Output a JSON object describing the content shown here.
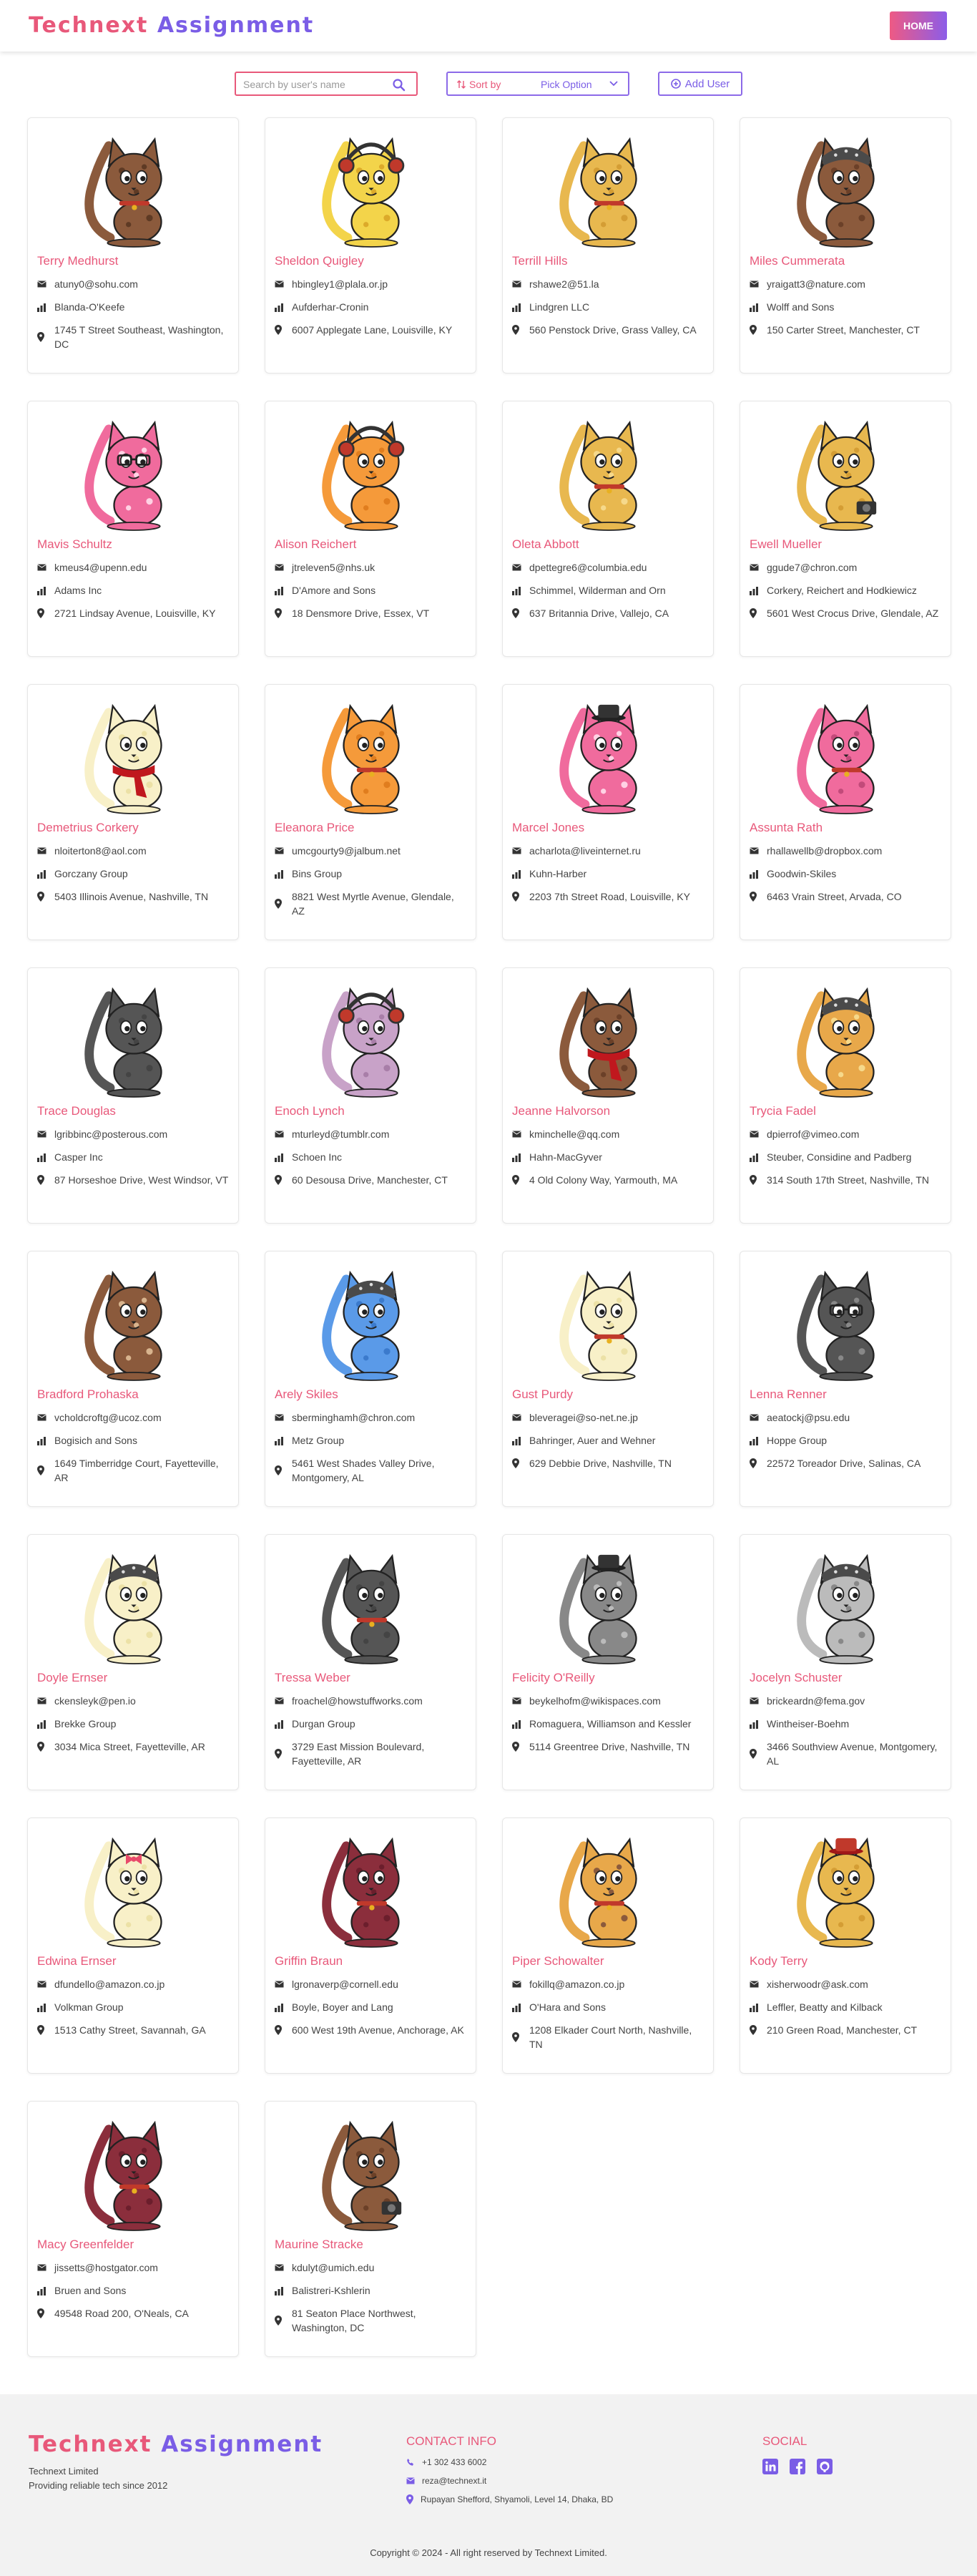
{
  "app": {
    "logo_part1": "Technext",
    "logo_part2": "Assignment",
    "home_label": "HOME"
  },
  "controls": {
    "search_placeholder": "Search by user's name",
    "sort_label": "Sort by",
    "sort_value": "Pick Option",
    "add_user_label": "Add User"
  },
  "colors": {
    "accent_pink": "#e8587a",
    "accent_purple": "#7a5de6"
  },
  "users": [
    {
      "name": "Terry Medhurst",
      "email": "atuny0@sohu.com",
      "company": "Blanda-O'Keefe",
      "address": "1745 T Street Southeast, Washington, DC",
      "cat": {
        "body": "#8b5a3c",
        "spots": "#5e3a24",
        "acc": "collar"
      }
    },
    {
      "name": "Sheldon Quigley",
      "email": "hbingley1@plala.or.jp",
      "company": "Aufderhar-Cronin",
      "address": "6007 Applegate Lane, Louisville, KY",
      "cat": {
        "body": "#f3d44a",
        "spots": "#dcaa2a",
        "acc": "headphones"
      }
    },
    {
      "name": "Terrill Hills",
      "email": "rshawe2@51.la",
      "company": "Lindgren LLC",
      "address": "560 Penstock Drive, Grass Valley, CA",
      "cat": {
        "body": "#e8b84f",
        "spots": "#d49d34",
        "acc": "collar"
      }
    },
    {
      "name": "Miles Cummerata",
      "email": "yraigatt3@nature.com",
      "company": "Wolff and Sons",
      "address": "150 Carter Street, Manchester, CT",
      "cat": {
        "body": "#8b5a3c",
        "spots": "#6b4028",
        "acc": "bandana"
      }
    },
    {
      "name": "Mavis Schultz",
      "email": "kmeus4@upenn.edu",
      "company": "Adams Inc",
      "address": "2721 Lindsay Avenue, Louisville, KY",
      "cat": {
        "body": "#f06b9d",
        "spots": "#ffd2e4",
        "acc": "glasses"
      }
    },
    {
      "name": "Alison Reichert",
      "email": "jtreleven5@nhs.uk",
      "company": "D'Amore and Sons",
      "address": "18 Densmore Drive, Essex, VT",
      "cat": {
        "body": "#f59a3a",
        "spots": "#e07d1e",
        "acc": "headphones"
      }
    },
    {
      "name": "Oleta Abbott",
      "email": "dpettegre6@columbia.edu",
      "company": "Schimmel, Wilderman and Orn",
      "address": "637 Britannia Drive, Vallejo, CA",
      "cat": {
        "body": "#e8b84f",
        "spots": "#f6d98b",
        "acc": "collar"
      }
    },
    {
      "name": "Ewell Mueller",
      "email": "ggude7@chron.com",
      "company": "Corkery, Reichert and Hodkiewicz",
      "address": "5601 West Crocus Drive, Glendale, AZ",
      "cat": {
        "body": "#e8b84f",
        "spots": "#d49d34",
        "acc": "camera"
      }
    },
    {
      "name": "Demetrius Corkery",
      "email": "nloiterton8@aol.com",
      "company": "Gorczany Group",
      "address": "5403 Illinois Avenue, Nashville, TN",
      "cat": {
        "body": "#f8f0c8",
        "spots": "#ece1a6",
        "acc": "scarf"
      }
    },
    {
      "name": "Eleanora Price",
      "email": "umcgourty9@jalbum.net",
      "company": "Bins Group",
      "address": "8821 West Myrtle Avenue, Glendale, AZ",
      "cat": {
        "body": "#f59a3a",
        "spots": "#e07d1e",
        "acc": "collar"
      }
    },
    {
      "name": "Marcel Jones",
      "email": "acharlota@liveinternet.ru",
      "company": "Kuhn-Harber",
      "address": "2203 7th Street Road, Louisville, KY",
      "cat": {
        "body": "#f06b9d",
        "spots": "#ffd2e4",
        "acc": "hat"
      }
    },
    {
      "name": "Assunta Rath",
      "email": "rhallawellb@dropbox.com",
      "company": "Goodwin-Skiles",
      "address": "6463 Vrain Street, Arvada, CO",
      "cat": {
        "body": "#f06b9d",
        "spots": "#c24a7a",
        "acc": "collar"
      }
    },
    {
      "name": "Trace Douglas",
      "email": "lgribbinc@posterous.com",
      "company": "Casper Inc",
      "address": "87 Horseshoe Drive, West Windsor, VT",
      "cat": {
        "body": "#555555",
        "spots": "#444444",
        "acc": "none"
      }
    },
    {
      "name": "Enoch Lynch",
      "email": "mturleyd@tumblr.com",
      "company": "Schoen Inc",
      "address": "60 Desousa Drive, Manchester, CT",
      "cat": {
        "body": "#c8a2c8",
        "spots": "#a87ea8",
        "acc": "headphones"
      }
    },
    {
      "name": "Jeanne Halvorson",
      "email": "kminchelle@qq.com",
      "company": "Hahn-MacGyver",
      "address": "4 Old Colony Way, Yarmouth, MA",
      "cat": {
        "body": "#8b5a3c",
        "spots": "#6b4028",
        "acc": "scarf"
      }
    },
    {
      "name": "Trycia Fadel",
      "email": "dpierrof@vimeo.com",
      "company": "Steuber, Considine and Padberg",
      "address": "314 South 17th Street, Nashville, TN",
      "cat": {
        "body": "#e8a84a",
        "spots": "#f6d98b",
        "acc": "bandana"
      }
    },
    {
      "name": "Bradford Prohaska",
      "email": "vcholdcroftg@ucoz.com",
      "company": "Bogisich and Sons",
      "address": "1649 Timberridge Court, Fayetteville, AR",
      "cat": {
        "body": "#8b5a3c",
        "spots": "#d8b48e",
        "acc": "none"
      }
    },
    {
      "name": "Arely Skiles",
      "email": "sberminghamh@chron.com",
      "company": "Metz Group",
      "address": "5461 West Shades Valley Drive, Montgomery, AL",
      "cat": {
        "body": "#5a9ae8",
        "spots": "#3b7acc",
        "acc": "bandana"
      }
    },
    {
      "name": "Gust Purdy",
      "email": "bleveragei@so-net.ne.jp",
      "company": "Bahringer, Auer and Wehner",
      "address": "629 Debbie Drive, Nashville, TN",
      "cat": {
        "body": "#f8f0c8",
        "spots": "#ece1a6",
        "acc": "collar"
      }
    },
    {
      "name": "Lenna Renner",
      "email": "aeatockj@psu.edu",
      "company": "Hoppe Group",
      "address": "22572 Toreador Drive, Salinas, CA",
      "cat": {
        "body": "#555555",
        "spots": "#888888",
        "acc": "glasses"
      }
    },
    {
      "name": "Doyle Ernser",
      "email": "ckensleyk@pen.io",
      "company": "Brekke Group",
      "address": "3034 Mica Street, Fayetteville, AR",
      "cat": {
        "body": "#f8f0c8",
        "spots": "#ece1a6",
        "acc": "bandana"
      }
    },
    {
      "name": "Tressa Weber",
      "email": "froachel@howstuffworks.com",
      "company": "Durgan Group",
      "address": "3729 East Mission Boulevard, Fayetteville, AR",
      "cat": {
        "body": "#555555",
        "spots": "#444444",
        "acc": "collar"
      }
    },
    {
      "name": "Felicity O'Reilly",
      "email": "beykelhofm@wikispaces.com",
      "company": "Romaguera, Williamson and Kessler",
      "address": "5114 Greentree Drive, Nashville, TN",
      "cat": {
        "body": "#888888",
        "spots": "#bbbbbb",
        "acc": "hat"
      }
    },
    {
      "name": "Jocelyn Schuster",
      "email": "brickeardn@fema.gov",
      "company": "Wintheiser-Boehm",
      "address": "3466 Southview Avenue, Montgomery, AL",
      "cat": {
        "body": "#bbbbbb",
        "spots": "#888888",
        "acc": "bandana"
      }
    },
    {
      "name": "Edwina Ernser",
      "email": "dfundello@amazon.co.jp",
      "company": "Volkman Group",
      "address": "1513 Cathy Street, Savannah, GA",
      "cat": {
        "body": "#f8f0c8",
        "spots": "#ece1a6",
        "acc": "bow"
      }
    },
    {
      "name": "Griffin Braun",
      "email": "lgronaverp@cornell.edu",
      "company": "Boyle, Boyer and Lang",
      "address": "600 West 19th Avenue, Anchorage, AK",
      "cat": {
        "body": "#8b2e3c",
        "spots": "#6b1e2c",
        "acc": "collar"
      }
    },
    {
      "name": "Piper Schowalter",
      "email": "fokillq@amazon.co.jp",
      "company": "O'Hara and Sons",
      "address": "1208 Elkader Court North, Nashville, TN",
      "cat": {
        "body": "#e8a84a",
        "spots": "#8b5a3c",
        "acc": "collar"
      }
    },
    {
      "name": "Kody Terry",
      "email": "xisherwoodr@ask.com",
      "company": "Leffler, Beatty and Kilback",
      "address": "210 Green Road, Manchester, CT",
      "cat": {
        "body": "#e8b84f",
        "spots": "#d49d34",
        "acc": "redhat"
      }
    },
    {
      "name": "Macy Greenfelder",
      "email": "jissetts@hostgator.com",
      "company": "Bruen and Sons",
      "address": "49548 Road 200, O'Neals, CA",
      "cat": {
        "body": "#8b2e3c",
        "spots": "#6b1e2c",
        "acc": "collar"
      }
    },
    {
      "name": "Maurine Stracke",
      "email": "kdulyt@umich.edu",
      "company": "Balistreri-Kshlerin",
      "address": "81 Seaton Place Northwest, Washington, DC",
      "cat": {
        "body": "#8b5a3c",
        "spots": "#6b4028",
        "acc": "camera"
      }
    }
  ],
  "footer": {
    "logo_part1": "Technext",
    "logo_part2": "Assignment",
    "company": "Technext Limited",
    "tagline": "Providing reliable tech since 2012",
    "contact_title": "CONTACT INFO",
    "phone": "+1 302 433 6002",
    "email": "reza@technext.it",
    "address": "Rupayan Shefford, Shyamoli, Level 14, Dhaka, BD",
    "social_title": "SOCIAL",
    "social_icons": [
      "linkedin-icon",
      "facebook-icon",
      "github-icon"
    ],
    "copyright": "Copyright © 2024 - All right reserved by Technext Limited."
  }
}
